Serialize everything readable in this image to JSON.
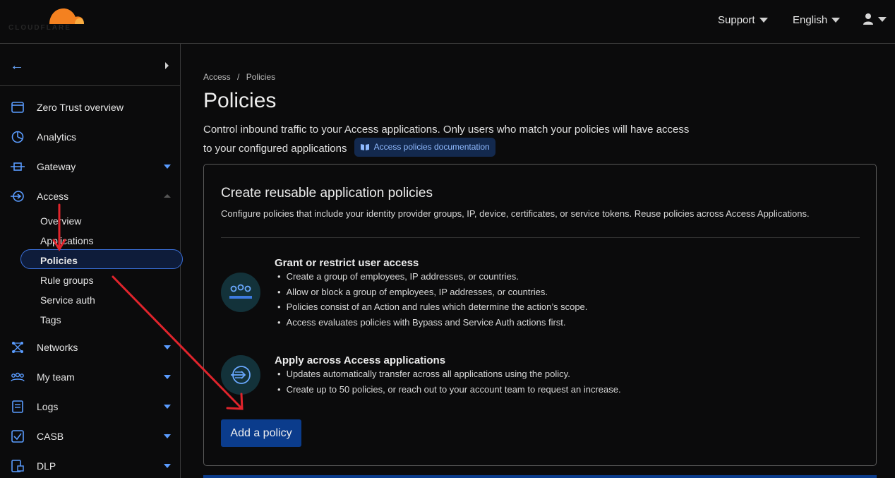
{
  "brand": {
    "logo_text": "CLOUDFLARE",
    "accent": "#f48120"
  },
  "topbar": {
    "support_label": "Support",
    "language_label": "English"
  },
  "sidebar": {
    "items": [
      {
        "label": "Zero Trust overview",
        "icon": "browser-window-icon"
      },
      {
        "label": "Analytics",
        "icon": "pie-chart-icon"
      },
      {
        "label": "Gateway",
        "icon": "gateway-icon"
      },
      {
        "label": "Access",
        "icon": "access-arrows-icon"
      },
      {
        "label": "Networks",
        "icon": "network-nodes-icon"
      },
      {
        "label": "My team",
        "icon": "team-icon"
      },
      {
        "label": "Logs",
        "icon": "document-icon"
      },
      {
        "label": "CASB",
        "icon": "checklist-icon"
      },
      {
        "label": "DLP",
        "icon": "data-lock-icon"
      }
    ],
    "access_sub": [
      "Overview",
      "Applications",
      "Policies",
      "Rule groups",
      "Service auth",
      "Tags"
    ],
    "active_sub": "Policies"
  },
  "main": {
    "breadcrumb": [
      "Access",
      "Policies"
    ],
    "breadcrumb_sep": "/",
    "title": "Policies",
    "description": "Control inbound traffic to your Access applications. Only users who match your policies will have access to your configured applications",
    "doc_link": "Access policies documentation",
    "card": {
      "title": "Create reusable application policies",
      "subtitle": "Configure policies that include your identity provider groups, IP, device, certificates, or service tokens. Reuse policies across Access Applications.",
      "features": [
        {
          "title": "Grant or restrict user access",
          "icon": "user-group-icon",
          "bullets": [
            "Create a group of employees, IP addresses, or countries.",
            "Allow or block a group of employees, IP addresses, or countries.",
            "Policies consist of an Action and rules which determine the action’s scope.",
            "Access evaluates policies with Bypass and Service Auth actions first."
          ]
        },
        {
          "title": "Apply across Access applications",
          "icon": "apply-arrow-icon",
          "bullets": [
            "Updates automatically transfer across all applications using the policy.",
            "Create up to 50 policies, or reach out to your account team to request an increase."
          ]
        }
      ],
      "button_label": "Add a policy"
    }
  },
  "annotations_color": "#e0242c"
}
